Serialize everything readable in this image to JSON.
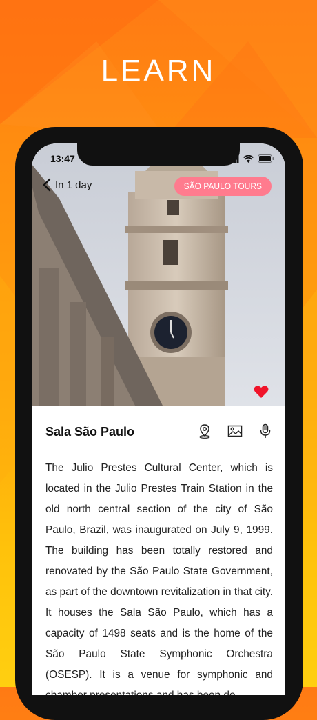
{
  "headline": "LEARN",
  "status": {
    "time": "13:47"
  },
  "nav": {
    "back_label": "In 1 day"
  },
  "tour_badge": "SÃO PAULO TOURS",
  "place": {
    "title": "Sala São Paulo",
    "description": "The Julio Prestes Cultural Center, which is located in the Julio Prestes Train Station in the old north central section of the city of São Paulo, Brazil, was inaugurated on July 9, 1999. The building has been totally restored and renovated by the São Paulo State Government, as part of the downtown revitalization in that city. It houses the Sala São Paulo, which has a capacity of 1498 seats and is the home of the São Paulo State Symphonic Orchestra (OSESP). It is a venue for symphonic and chamber presentations and has been de-"
  },
  "icons": [
    "back-chevron-icon",
    "signal-icon",
    "wifi-icon",
    "battery-icon",
    "heart-icon",
    "location-pin-icon",
    "gallery-icon",
    "microphone-icon"
  ],
  "colors": {
    "accent_pink": "#ff7b8e",
    "heart_red": "#f0142a",
    "background_top": "#ff7a14",
    "background_bottom": "#ffcf10"
  }
}
